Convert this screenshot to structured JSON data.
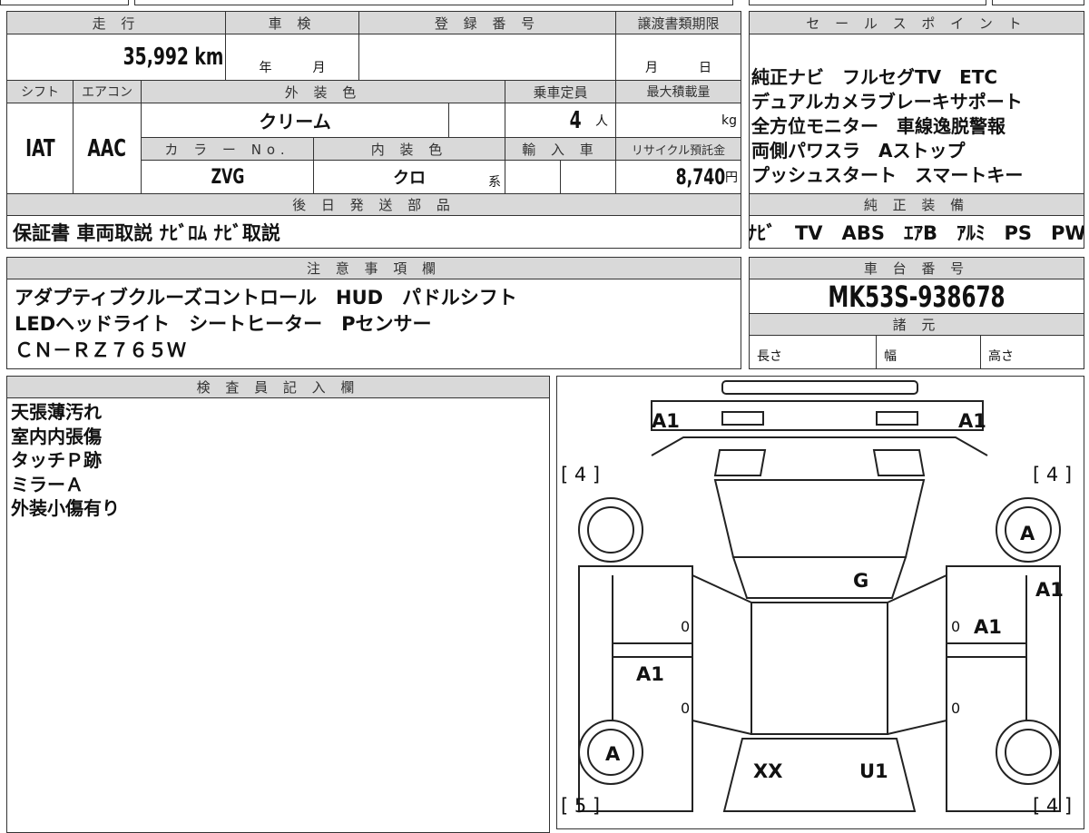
{
  "main_table": {
    "mileage_label": "走 行",
    "mileage": "35,992 km",
    "inspection_label": "車 検",
    "inspection_year": "年",
    "inspection_month": "月",
    "registration_label": "登 録 番 号",
    "transfer_deadline_label": "譲渡書類期限",
    "transfer_month": "月",
    "transfer_day": "日",
    "shift_label": "シフト",
    "shift": "IAT",
    "aircon_label": "エアコン",
    "aircon": "AAC",
    "exterior_color_label": "外 装 色",
    "exterior_color": "クリーム",
    "capacity_label": "乗車定員",
    "capacity": "4",
    "capacity_unit": "人",
    "max_load_label": "最大積載量",
    "max_load_unit": "kg",
    "color_no_label": "カ ラ ー No.",
    "color_no": "ZVG",
    "interior_color_label": "内 装 色",
    "interior_color": "クロ",
    "interior_suffix": "系",
    "import_label": "輸 入 車",
    "recycle_label": "リサイクル預託金",
    "recycle_fee": "8,740",
    "recycle_unit": "円",
    "later_parts_label": "後 日 発 送 部 品",
    "later_parts": "保証書 車両取説 ﾅﾋﾞﾛﾑ ﾅﾋﾞ取説"
  },
  "sales_points": {
    "label": "セ ー ル ス ポ イ ン ト",
    "lines": [
      "純正ナビ　フルセグTV　ETC",
      "デュアルカメラブレーキサポート",
      "全方位モニター　車線逸脱警報",
      "両側パワスラ　Aストップ",
      "プッシュスタート　スマートキー"
    ],
    "genuine_label": "純 正 装 備",
    "genuine": "ﾅﾋﾞ　TV　ABS　ｴｱB　ｱﾙﾐ　PS　PW"
  },
  "notes": {
    "label": "注 意 事 項 欄",
    "lines": [
      "アダプティブクルーズコントロール　HUD　パドルシフト",
      "LEDヘッドライト　シートヒーター　Pセンサー",
      "ＣＮ－ＲＺ７６５Ｗ"
    ]
  },
  "chassis": {
    "label": "車 台 番 号",
    "number": "MK53S-938678",
    "specs_label": "諸 元",
    "length": "長さ",
    "width": "幅",
    "height": "高さ"
  },
  "inspector": {
    "label": "検 査 員 記 入 欄",
    "lines": [
      "天張薄汚れ",
      "室内内張傷",
      "タッチＰ跡",
      "ミラーＡ",
      "外装小傷有り"
    ]
  },
  "diagram": {
    "marks": {
      "front_left": "A1",
      "front_right": "A1",
      "tire_fl": "[ 4 ]",
      "tire_fr": "[ 4 ]",
      "tire_rl": "[ 5 ]",
      "tire_rr": "[ 4 ]",
      "wheel_fr": "A",
      "wheel_rl": "A",
      "roof": "G",
      "right_fender": "A1",
      "right_door": "A1",
      "left_rear_door": "A1",
      "rear_left": "XX",
      "rear_right": "U1",
      "z1": "0",
      "z2": "0",
      "z3": "0",
      "z4": "0"
    }
  }
}
